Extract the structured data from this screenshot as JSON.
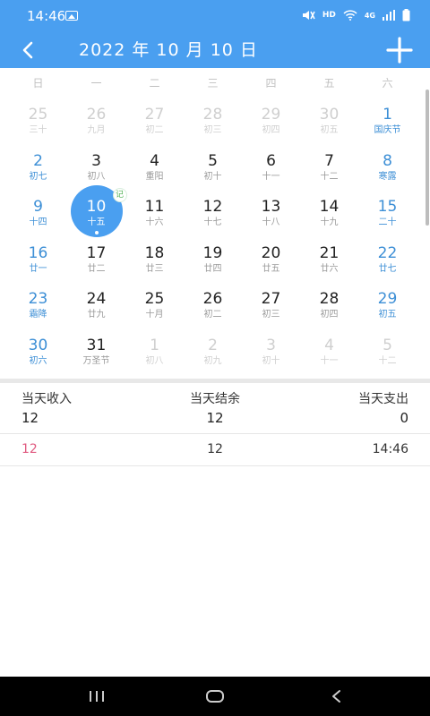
{
  "status_bar": {
    "time": "14:46",
    "network_label": "HD",
    "network_type": "4G"
  },
  "header": {
    "title": "2022 年 10 月 10 日"
  },
  "weekdays": [
    "日",
    "一",
    "二",
    "三",
    "四",
    "五",
    "六"
  ],
  "calendar": {
    "weeks": [
      [
        {
          "d": "25",
          "l": "三十",
          "s": "other"
        },
        {
          "d": "26",
          "l": "九月",
          "s": "other"
        },
        {
          "d": "27",
          "l": "初二",
          "s": "other"
        },
        {
          "d": "28",
          "l": "初三",
          "s": "other"
        },
        {
          "d": "29",
          "l": "初四",
          "s": "other"
        },
        {
          "d": "30",
          "l": "初五",
          "s": "other"
        },
        {
          "d": "1",
          "l": "国庆节",
          "s": "weekend"
        }
      ],
      [
        {
          "d": "2",
          "l": "初七",
          "s": "weekend"
        },
        {
          "d": "3",
          "l": "初八",
          "s": "normal"
        },
        {
          "d": "4",
          "l": "重阳",
          "s": "normal"
        },
        {
          "d": "5",
          "l": "初十",
          "s": "normal"
        },
        {
          "d": "6",
          "l": "十一",
          "s": "normal"
        },
        {
          "d": "7",
          "l": "十二",
          "s": "normal"
        },
        {
          "d": "8",
          "l": "寒露",
          "s": "weekend"
        }
      ],
      [
        {
          "d": "9",
          "l": "十四",
          "s": "weekend"
        },
        {
          "d": "10",
          "l": "十五",
          "s": "selected",
          "badge": "记"
        },
        {
          "d": "11",
          "l": "十六",
          "s": "normal"
        },
        {
          "d": "12",
          "l": "十七",
          "s": "normal"
        },
        {
          "d": "13",
          "l": "十八",
          "s": "normal"
        },
        {
          "d": "14",
          "l": "十九",
          "s": "normal"
        },
        {
          "d": "15",
          "l": "二十",
          "s": "weekend"
        }
      ],
      [
        {
          "d": "16",
          "l": "廿一",
          "s": "weekend"
        },
        {
          "d": "17",
          "l": "廿二",
          "s": "normal"
        },
        {
          "d": "18",
          "l": "廿三",
          "s": "normal"
        },
        {
          "d": "19",
          "l": "廿四",
          "s": "normal"
        },
        {
          "d": "20",
          "l": "廿五",
          "s": "normal"
        },
        {
          "d": "21",
          "l": "廿六",
          "s": "normal"
        },
        {
          "d": "22",
          "l": "廿七",
          "s": "weekend"
        }
      ],
      [
        {
          "d": "23",
          "l": "霜降",
          "s": "weekend"
        },
        {
          "d": "24",
          "l": "廿九",
          "s": "normal"
        },
        {
          "d": "25",
          "l": "十月",
          "s": "normal"
        },
        {
          "d": "26",
          "l": "初二",
          "s": "normal"
        },
        {
          "d": "27",
          "l": "初三",
          "s": "normal"
        },
        {
          "d": "28",
          "l": "初四",
          "s": "normal"
        },
        {
          "d": "29",
          "l": "初五",
          "s": "weekend"
        }
      ],
      [
        {
          "d": "30",
          "l": "初六",
          "s": "weekend"
        },
        {
          "d": "31",
          "l": "万圣节",
          "s": "normal"
        },
        {
          "d": "1",
          "l": "初八",
          "s": "other"
        },
        {
          "d": "2",
          "l": "初九",
          "s": "other"
        },
        {
          "d": "3",
          "l": "初十",
          "s": "other"
        },
        {
          "d": "4",
          "l": "十一",
          "s": "other"
        },
        {
          "d": "5",
          "l": "十二",
          "s": "other"
        }
      ]
    ]
  },
  "summary": {
    "income_label": "当天收入",
    "income_value": "12",
    "balance_label": "当天结余",
    "balance_value": "12",
    "expense_label": "当天支出",
    "expense_value": "0"
  },
  "records": [
    {
      "income": "12",
      "balance": "12",
      "time": "14:46"
    }
  ],
  "colors": {
    "accent": "#4a9ff0",
    "weekend": "#3d8fd6",
    "income": "#e05a80",
    "badge": "#4caf50"
  }
}
